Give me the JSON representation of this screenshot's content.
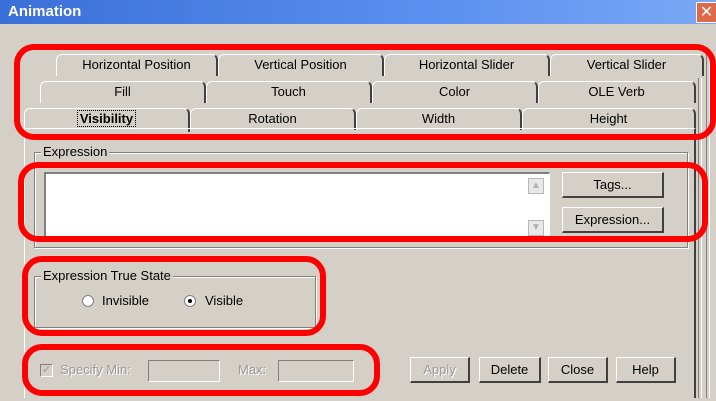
{
  "window": {
    "title": "Animation",
    "close_glyph": "✕"
  },
  "tabs": {
    "row1": [
      "Horizontal Position",
      "Vertical Position",
      "Horizontal Slider",
      "Vertical Slider"
    ],
    "row2": [
      "Fill",
      "Touch",
      "Color",
      "OLE Verb"
    ],
    "row3": [
      "Visibility",
      "Rotation",
      "Width",
      "Height"
    ],
    "active": "Visibility"
  },
  "expression": {
    "group_label": "Expression",
    "value": "",
    "tags_button": "Tags...",
    "expression_button": "Expression...",
    "scroll_up_glyph": "▲",
    "scroll_down_glyph": "▼"
  },
  "true_state": {
    "group_label": "Expression True State",
    "options": [
      "Invisible",
      "Visible"
    ],
    "selected": "Visible"
  },
  "bottom": {
    "specify_min_label": "Specify Min:",
    "specify_min_checked": true,
    "check_glyph": "✓",
    "min_value": "",
    "max_label": "Max:",
    "max_value": "",
    "apply": "Apply",
    "delete": "Delete",
    "close": "Close",
    "help": "Help"
  },
  "colors": {
    "highlight": "#ff0000",
    "titlebar": "#3a6fd8",
    "dialog_bg": "#d4d0c8"
  }
}
